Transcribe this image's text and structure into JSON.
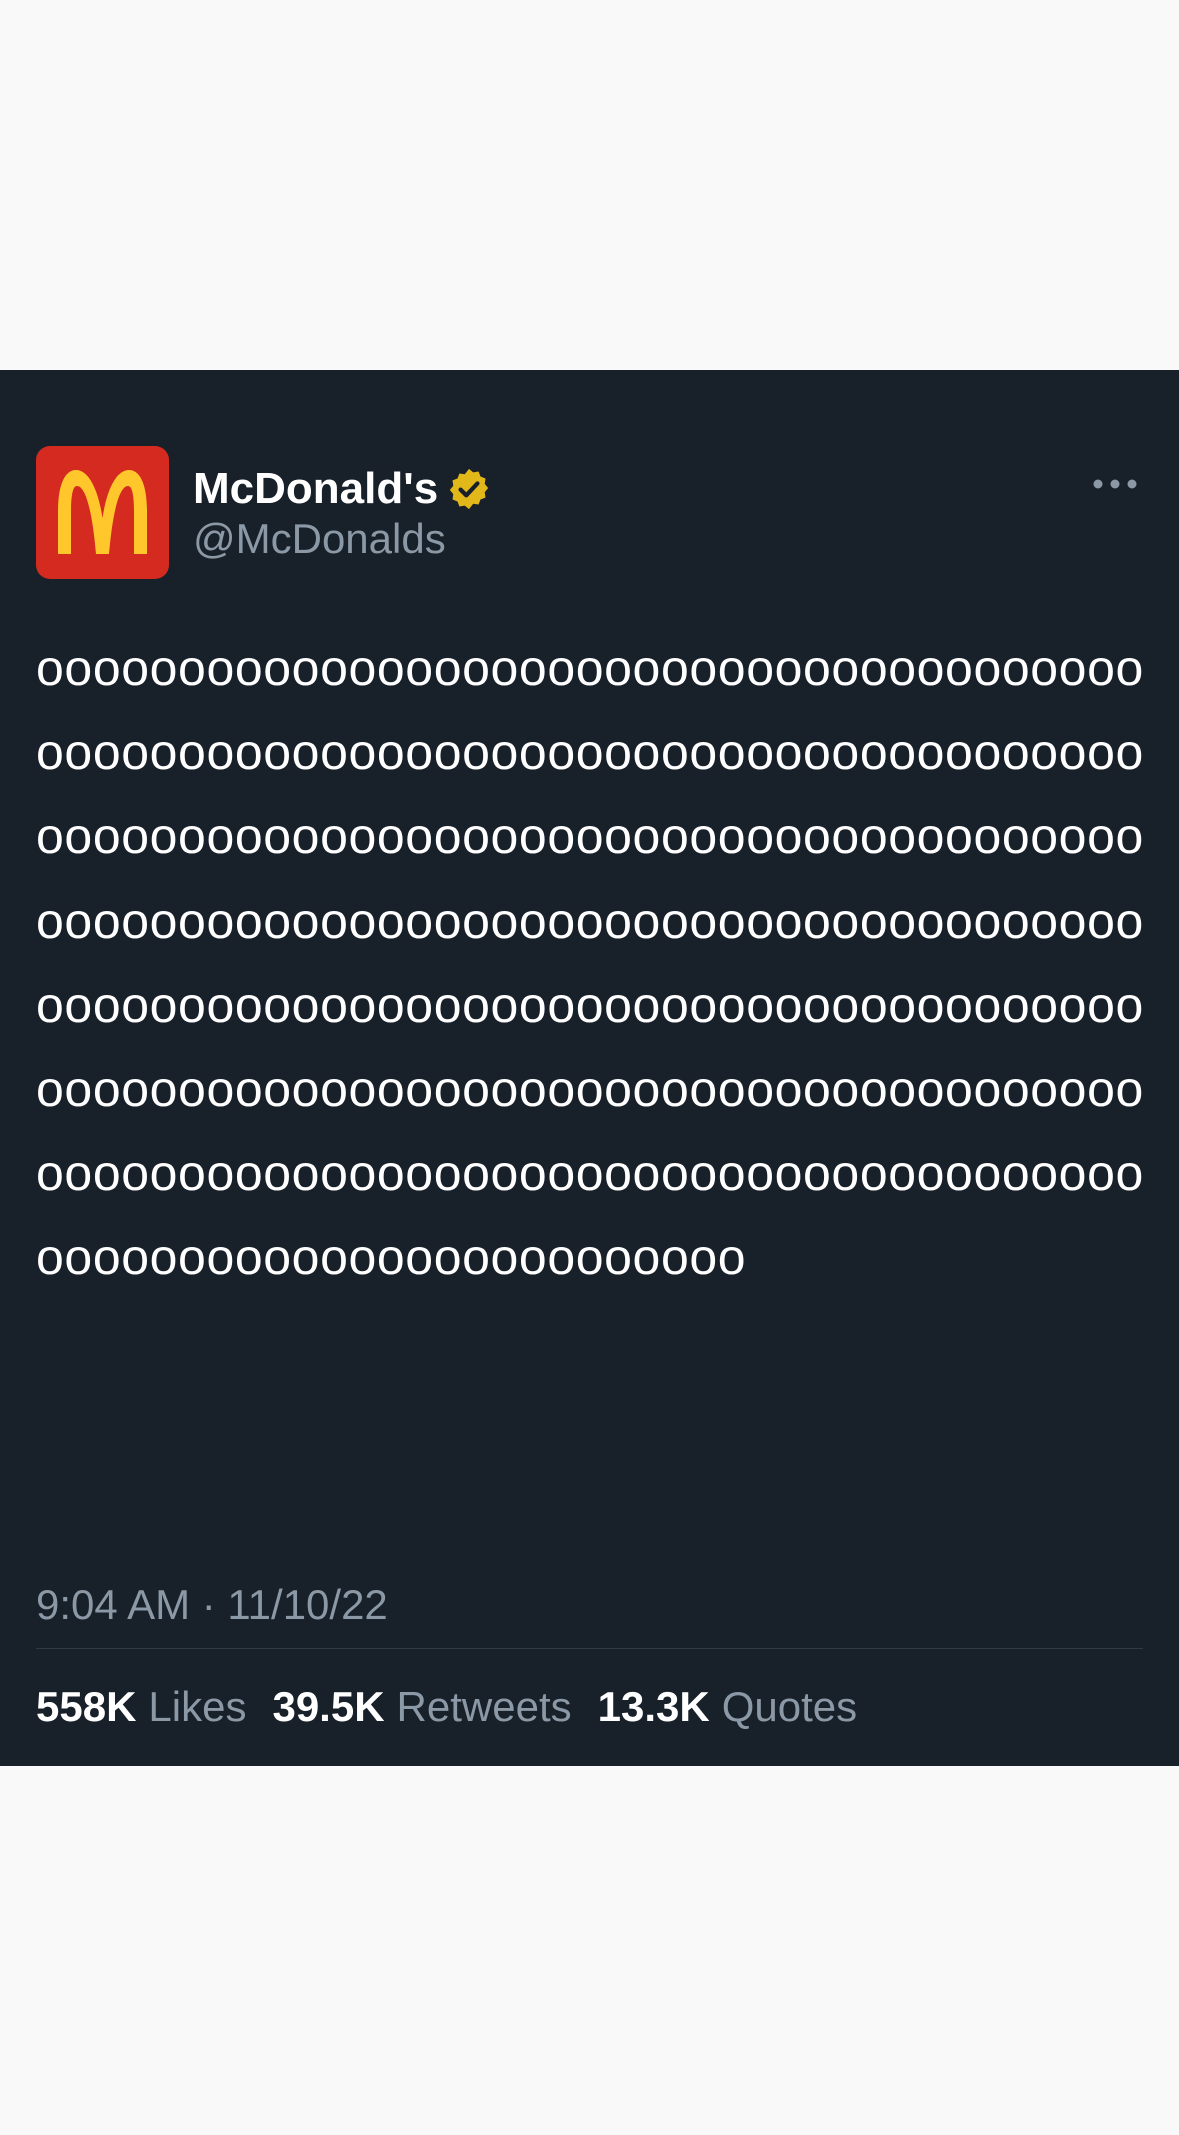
{
  "author": {
    "display_name": "McDonald's",
    "handle": "@McDonalds",
    "verified": true,
    "avatar_icon": "mcdonalds-golden-arches-logo"
  },
  "tweet": {
    "text": "oooooooooooooooooooooooooooooooooooooooooooooooooooooooooooooooooooooooooooooooooooooooooooooooooooooooooooooooooooooooooooooooooooooooooooooooooooooooooooooooooooooooooooooooooooooooooooooooooooooooooooooooooooooooooooooooooooooooooooooooooooooooooooooooooooooooooooooooooooooooooooooooooooooooooo",
    "timestamp": "9:04 AM · 11/10/22"
  },
  "stats": {
    "likes_count": "558K",
    "likes_label": "Likes",
    "retweets_count": "39.5K",
    "retweets_label": "Retweets",
    "quotes_count": "13.3K",
    "quotes_label": "Quotes"
  },
  "colors": {
    "page_background": "#f9f9f9",
    "card_background": "#18202a",
    "primary_text": "#ffffff",
    "secondary_text": "#8b98a5",
    "avatar_red": "#d42a1f",
    "arches_yellow": "#ffc72c",
    "verified_gold": "#e2b719"
  }
}
